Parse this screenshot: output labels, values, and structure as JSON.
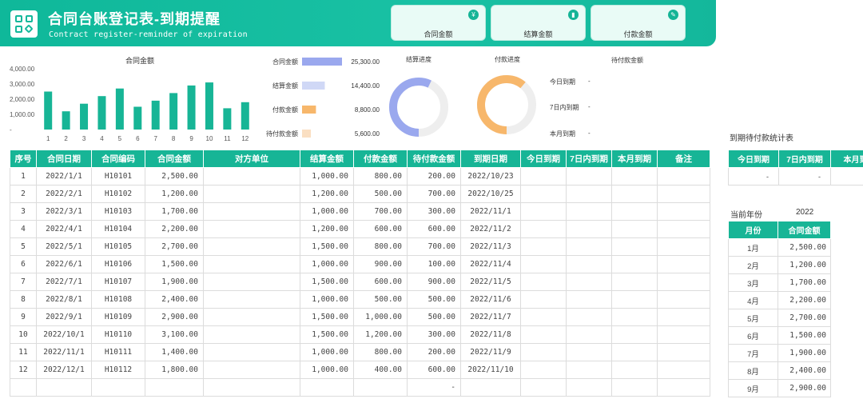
{
  "header": {
    "title": "合同台账登记表-到期提醒",
    "subtitle": "Contract register-reminder of expiration",
    "kpi_cards": [
      {
        "label": "合同金额",
        "icon": "yen-icon"
      },
      {
        "label": "结算金额",
        "icon": "chart-icon"
      },
      {
        "label": "付款金额",
        "icon": "edit-icon"
      }
    ]
  },
  "chart_data": [
    {
      "type": "bar",
      "title": "合同金额",
      "categories": [
        "1",
        "2",
        "3",
        "4",
        "5",
        "6",
        "7",
        "8",
        "9",
        "10",
        "11",
        "12"
      ],
      "values": [
        2500,
        1200,
        1700,
        2200,
        2700,
        1500,
        1900,
        2400,
        2900,
        3100,
        1400,
        1800
      ],
      "ylim": [
        0,
        4000
      ],
      "yticks": [
        "4,000.00",
        "3,000.00",
        "2,000.00",
        "1,000.00",
        "-"
      ],
      "color": "#17b596"
    },
    {
      "type": "bar",
      "orientation": "horizontal",
      "categories": [
        "合同金额",
        "结算金额",
        "付款金额",
        "待付款金额"
      ],
      "values": [
        25300,
        14400,
        8800,
        5600
      ],
      "value_labels": [
        "25,300.00",
        "14,400.00",
        "8,800.00",
        "5,600.00"
      ],
      "colors": [
        "#9aa8ee",
        "#d0d8f6",
        "#f7b76b",
        "#fadfc2"
      ]
    },
    {
      "type": "pie",
      "variant": "donut",
      "title": "结算进度",
      "progress": 0.57,
      "color": "#9aa8ee",
      "track": "#eeeeee"
    },
    {
      "type": "pie",
      "variant": "donut",
      "title": "付款进度",
      "progress": 0.61,
      "color": "#f7b76b",
      "track": "#eeeeee"
    }
  ],
  "pending_summary": {
    "title": "待付款金额",
    "rows": [
      {
        "name": "今日到期",
        "value": "-"
      },
      {
        "name": "7日内到期",
        "value": "-"
      },
      {
        "name": "本月到期",
        "value": "-"
      }
    ]
  },
  "main_table": {
    "headers": [
      "序号",
      "合同日期",
      "合同编码",
      "合同金额",
      "对方单位",
      "结算金额",
      "付款金额",
      "待付款金额",
      "到期日期",
      "今日到期",
      "7日内到期",
      "本月到期",
      "备注"
    ],
    "rows": [
      [
        "1",
        "2022/1/1",
        "H10101",
        "2,500.00",
        "",
        "1,000.00",
        "800.00",
        "200.00",
        "2022/10/23",
        "",
        "",
        "",
        ""
      ],
      [
        "2",
        "2022/2/1",
        "H10102",
        "1,200.00",
        "",
        "1,200.00",
        "500.00",
        "700.00",
        "2022/10/25",
        "",
        "",
        "",
        ""
      ],
      [
        "3",
        "2022/3/1",
        "H10103",
        "1,700.00",
        "",
        "1,000.00",
        "700.00",
        "300.00",
        "2022/11/1",
        "",
        "",
        "",
        ""
      ],
      [
        "4",
        "2022/4/1",
        "H10104",
        "2,200.00",
        "",
        "1,200.00",
        "600.00",
        "600.00",
        "2022/11/2",
        "",
        "",
        "",
        ""
      ],
      [
        "5",
        "2022/5/1",
        "H10105",
        "2,700.00",
        "",
        "1,500.00",
        "800.00",
        "700.00",
        "2022/11/3",
        "",
        "",
        "",
        ""
      ],
      [
        "6",
        "2022/6/1",
        "H10106",
        "1,500.00",
        "",
        "1,000.00",
        "900.00",
        "100.00",
        "2022/11/4",
        "",
        "",
        "",
        ""
      ],
      [
        "7",
        "2022/7/1",
        "H10107",
        "1,900.00",
        "",
        "1,500.00",
        "600.00",
        "900.00",
        "2022/11/5",
        "",
        "",
        "",
        ""
      ],
      [
        "8",
        "2022/8/1",
        "H10108",
        "2,400.00",
        "",
        "1,000.00",
        "500.00",
        "500.00",
        "2022/11/6",
        "",
        "",
        "",
        ""
      ],
      [
        "9",
        "2022/9/1",
        "H10109",
        "2,900.00",
        "",
        "1,500.00",
        "1,000.00",
        "500.00",
        "2022/11/7",
        "",
        "",
        "",
        ""
      ],
      [
        "10",
        "2022/10/1",
        "H10110",
        "3,100.00",
        "",
        "1,500.00",
        "1,200.00",
        "300.00",
        "2022/11/8",
        "",
        "",
        "",
        ""
      ],
      [
        "11",
        "2022/11/1",
        "H10111",
        "1,400.00",
        "",
        "1,000.00",
        "800.00",
        "200.00",
        "2022/11/9",
        "",
        "",
        "",
        ""
      ],
      [
        "12",
        "2022/12/1",
        "H10112",
        "1,800.00",
        "",
        "1,000.00",
        "400.00",
        "600.00",
        "2022/11/10",
        "",
        "",
        "",
        ""
      ],
      [
        "",
        "",
        "",
        "",
        "",
        "",
        "",
        "-",
        "",
        "",
        "",
        "",
        ""
      ]
    ]
  },
  "due_stats": {
    "title": "到期待付款统计表",
    "headers": [
      "今日到期",
      "7日内到期",
      "本月到期"
    ],
    "values": [
      "-",
      "-",
      "-"
    ]
  },
  "year_summary": {
    "label": "当前年份",
    "year": "2022",
    "headers": [
      "月份",
      "合同金额"
    ],
    "rows": [
      [
        "1月",
        "2,500.00"
      ],
      [
        "2月",
        "1,200.00"
      ],
      [
        "3月",
        "1,700.00"
      ],
      [
        "4月",
        "2,200.00"
      ],
      [
        "5月",
        "2,700.00"
      ],
      [
        "6月",
        "1,500.00"
      ],
      [
        "7月",
        "1,900.00"
      ],
      [
        "8月",
        "2,400.00"
      ],
      [
        "9月",
        "2,900.00"
      ]
    ]
  }
}
